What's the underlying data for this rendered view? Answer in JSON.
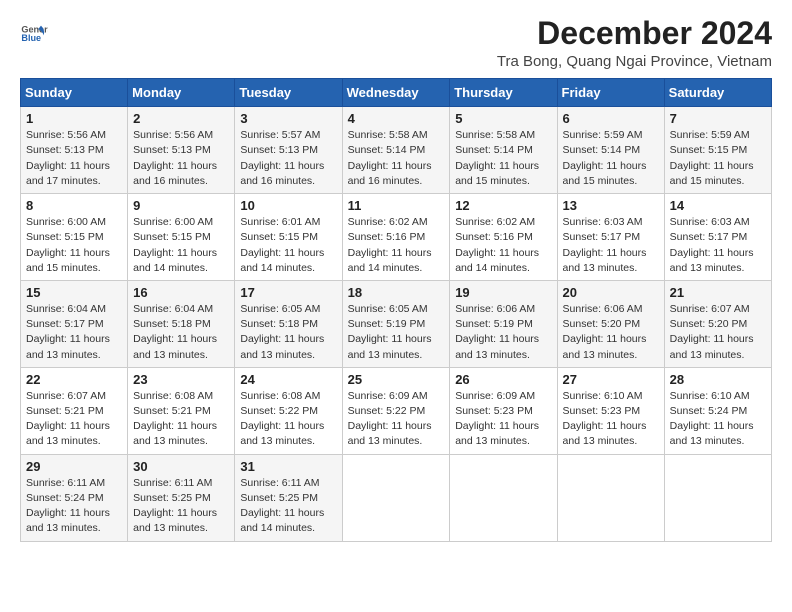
{
  "logo": {
    "name": "General",
    "name2": "Blue"
  },
  "title": "December 2024",
  "location": "Tra Bong, Quang Ngai Province, Vietnam",
  "days_of_week": [
    "Sunday",
    "Monday",
    "Tuesday",
    "Wednesday",
    "Thursday",
    "Friday",
    "Saturday"
  ],
  "weeks": [
    [
      {
        "day": "1",
        "sunrise": "5:56 AM",
        "sunset": "5:13 PM",
        "daylight": "11 hours and 17 minutes."
      },
      {
        "day": "2",
        "sunrise": "5:56 AM",
        "sunset": "5:13 PM",
        "daylight": "11 hours and 16 minutes."
      },
      {
        "day": "3",
        "sunrise": "5:57 AM",
        "sunset": "5:13 PM",
        "daylight": "11 hours and 16 minutes."
      },
      {
        "day": "4",
        "sunrise": "5:58 AM",
        "sunset": "5:14 PM",
        "daylight": "11 hours and 16 minutes."
      },
      {
        "day": "5",
        "sunrise": "5:58 AM",
        "sunset": "5:14 PM",
        "daylight": "11 hours and 15 minutes."
      },
      {
        "day": "6",
        "sunrise": "5:59 AM",
        "sunset": "5:14 PM",
        "daylight": "11 hours and 15 minutes."
      },
      {
        "day": "7",
        "sunrise": "5:59 AM",
        "sunset": "5:15 PM",
        "daylight": "11 hours and 15 minutes."
      }
    ],
    [
      {
        "day": "8",
        "sunrise": "6:00 AM",
        "sunset": "5:15 PM",
        "daylight": "11 hours and 15 minutes."
      },
      {
        "day": "9",
        "sunrise": "6:00 AM",
        "sunset": "5:15 PM",
        "daylight": "11 hours and 14 minutes."
      },
      {
        "day": "10",
        "sunrise": "6:01 AM",
        "sunset": "5:15 PM",
        "daylight": "11 hours and 14 minutes."
      },
      {
        "day": "11",
        "sunrise": "6:02 AM",
        "sunset": "5:16 PM",
        "daylight": "11 hours and 14 minutes."
      },
      {
        "day": "12",
        "sunrise": "6:02 AM",
        "sunset": "5:16 PM",
        "daylight": "11 hours and 14 minutes."
      },
      {
        "day": "13",
        "sunrise": "6:03 AM",
        "sunset": "5:17 PM",
        "daylight": "11 hours and 13 minutes."
      },
      {
        "day": "14",
        "sunrise": "6:03 AM",
        "sunset": "5:17 PM",
        "daylight": "11 hours and 13 minutes."
      }
    ],
    [
      {
        "day": "15",
        "sunrise": "6:04 AM",
        "sunset": "5:17 PM",
        "daylight": "11 hours and 13 minutes."
      },
      {
        "day": "16",
        "sunrise": "6:04 AM",
        "sunset": "5:18 PM",
        "daylight": "11 hours and 13 minutes."
      },
      {
        "day": "17",
        "sunrise": "6:05 AM",
        "sunset": "5:18 PM",
        "daylight": "11 hours and 13 minutes."
      },
      {
        "day": "18",
        "sunrise": "6:05 AM",
        "sunset": "5:19 PM",
        "daylight": "11 hours and 13 minutes."
      },
      {
        "day": "19",
        "sunrise": "6:06 AM",
        "sunset": "5:19 PM",
        "daylight": "11 hours and 13 minutes."
      },
      {
        "day": "20",
        "sunrise": "6:06 AM",
        "sunset": "5:20 PM",
        "daylight": "11 hours and 13 minutes."
      },
      {
        "day": "21",
        "sunrise": "6:07 AM",
        "sunset": "5:20 PM",
        "daylight": "11 hours and 13 minutes."
      }
    ],
    [
      {
        "day": "22",
        "sunrise": "6:07 AM",
        "sunset": "5:21 PM",
        "daylight": "11 hours and 13 minutes."
      },
      {
        "day": "23",
        "sunrise": "6:08 AM",
        "sunset": "5:21 PM",
        "daylight": "11 hours and 13 minutes."
      },
      {
        "day": "24",
        "sunrise": "6:08 AM",
        "sunset": "5:22 PM",
        "daylight": "11 hours and 13 minutes."
      },
      {
        "day": "25",
        "sunrise": "6:09 AM",
        "sunset": "5:22 PM",
        "daylight": "11 hours and 13 minutes."
      },
      {
        "day": "26",
        "sunrise": "6:09 AM",
        "sunset": "5:23 PM",
        "daylight": "11 hours and 13 minutes."
      },
      {
        "day": "27",
        "sunrise": "6:10 AM",
        "sunset": "5:23 PM",
        "daylight": "11 hours and 13 minutes."
      },
      {
        "day": "28",
        "sunrise": "6:10 AM",
        "sunset": "5:24 PM",
        "daylight": "11 hours and 13 minutes."
      }
    ],
    [
      {
        "day": "29",
        "sunrise": "6:11 AM",
        "sunset": "5:24 PM",
        "daylight": "11 hours and 13 minutes."
      },
      {
        "day": "30",
        "sunrise": "6:11 AM",
        "sunset": "5:25 PM",
        "daylight": "11 hours and 13 minutes."
      },
      {
        "day": "31",
        "sunrise": "6:11 AM",
        "sunset": "5:25 PM",
        "daylight": "11 hours and 14 minutes."
      },
      null,
      null,
      null,
      null
    ]
  ]
}
